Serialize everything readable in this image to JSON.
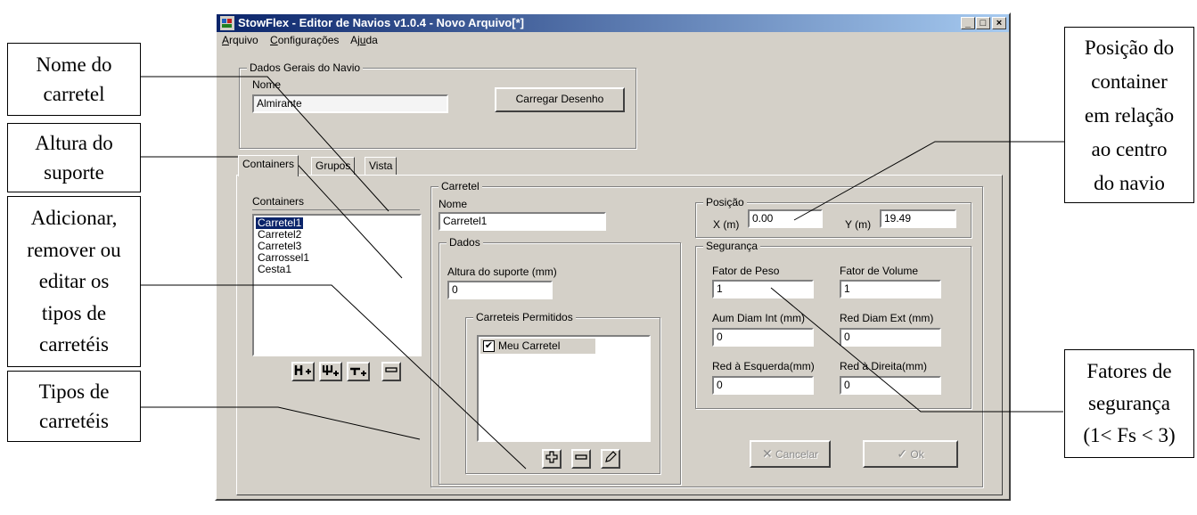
{
  "window": {
    "title": "StowFlex - Editor de Navios v1.0.4 - Novo Arquivo[*]",
    "controls": [
      "_",
      "□",
      "×"
    ]
  },
  "menu": {
    "arquivo": {
      "u": "A",
      "rest": "rquivo"
    },
    "configuracoes": {
      "u": "C",
      "rest": "onfigurações"
    },
    "ajuda": {
      "pre": "Aj",
      "u": "u",
      "rest": "da"
    }
  },
  "dados_gerais": {
    "title": "Dados Gerais do Navio",
    "nome_label": "Nome",
    "nome_value": "Almirante",
    "carregar_label": "Carregar Desenho"
  },
  "tabs": [
    "Containers",
    "Grupos",
    "Vista"
  ],
  "containers": {
    "label": "Containers",
    "items": [
      "Carretel1",
      "Carretel2",
      "Carretel3",
      "Carrossel1",
      "Cesta1"
    ],
    "selected_index": 0
  },
  "carretel": {
    "title": "Carretel",
    "nome_label": "Nome",
    "nome_value": "Carretel1",
    "dados_title": "Dados",
    "altura_label": "Altura do suporte (mm)",
    "altura_value": "0",
    "permitidos_title": "Carreteis Permitidos",
    "permitidos_items": [
      {
        "label": "Meu Carretel",
        "checked": true
      }
    ]
  },
  "posicao": {
    "title": "Posição",
    "x_label": "X (m)",
    "x_value": "0.00",
    "y_label": "Y (m)",
    "y_value": "19.49"
  },
  "seguranca": {
    "title": "Segurança",
    "fator_peso_label": "Fator de Peso",
    "fator_peso_value": "1",
    "fator_volume_label": "Fator de Volume",
    "fator_volume_value": "1",
    "aum_diam_int_label": "Aum Diam Int (mm)",
    "aum_diam_int_value": "0",
    "red_diam_ext_label": "Red Diam Ext (mm)",
    "red_diam_ext_value": "0",
    "red_esquerda_label": "Red à Esquerda(mm)",
    "red_esquerda_value": "0",
    "red_direita_label": "Red à Direita(mm)",
    "red_direita_value": "0"
  },
  "buttons": {
    "cancelar": "Cancelar",
    "ok": "Ok"
  },
  "annotations": {
    "nome_carretel": [
      "Nome do",
      "carretel"
    ],
    "altura_suporte": [
      "Altura do",
      "suporte"
    ],
    "adicionar": [
      "Adicionar,",
      "remover ou",
      "editar os",
      "tipos de",
      "carretéis"
    ],
    "tipos": [
      "Tipos de",
      "carretéis"
    ],
    "posicao": [
      "Posição do",
      "container",
      "em relação",
      "ao centro",
      "do navio"
    ],
    "fatores": [
      "Fatores de",
      "segurança",
      "(1< Fs < 3)"
    ]
  },
  "colors": {
    "title_start": "#0a246a",
    "title_end": "#a6caf0",
    "face": "#d4d0c8",
    "selection": "#0a246a"
  }
}
